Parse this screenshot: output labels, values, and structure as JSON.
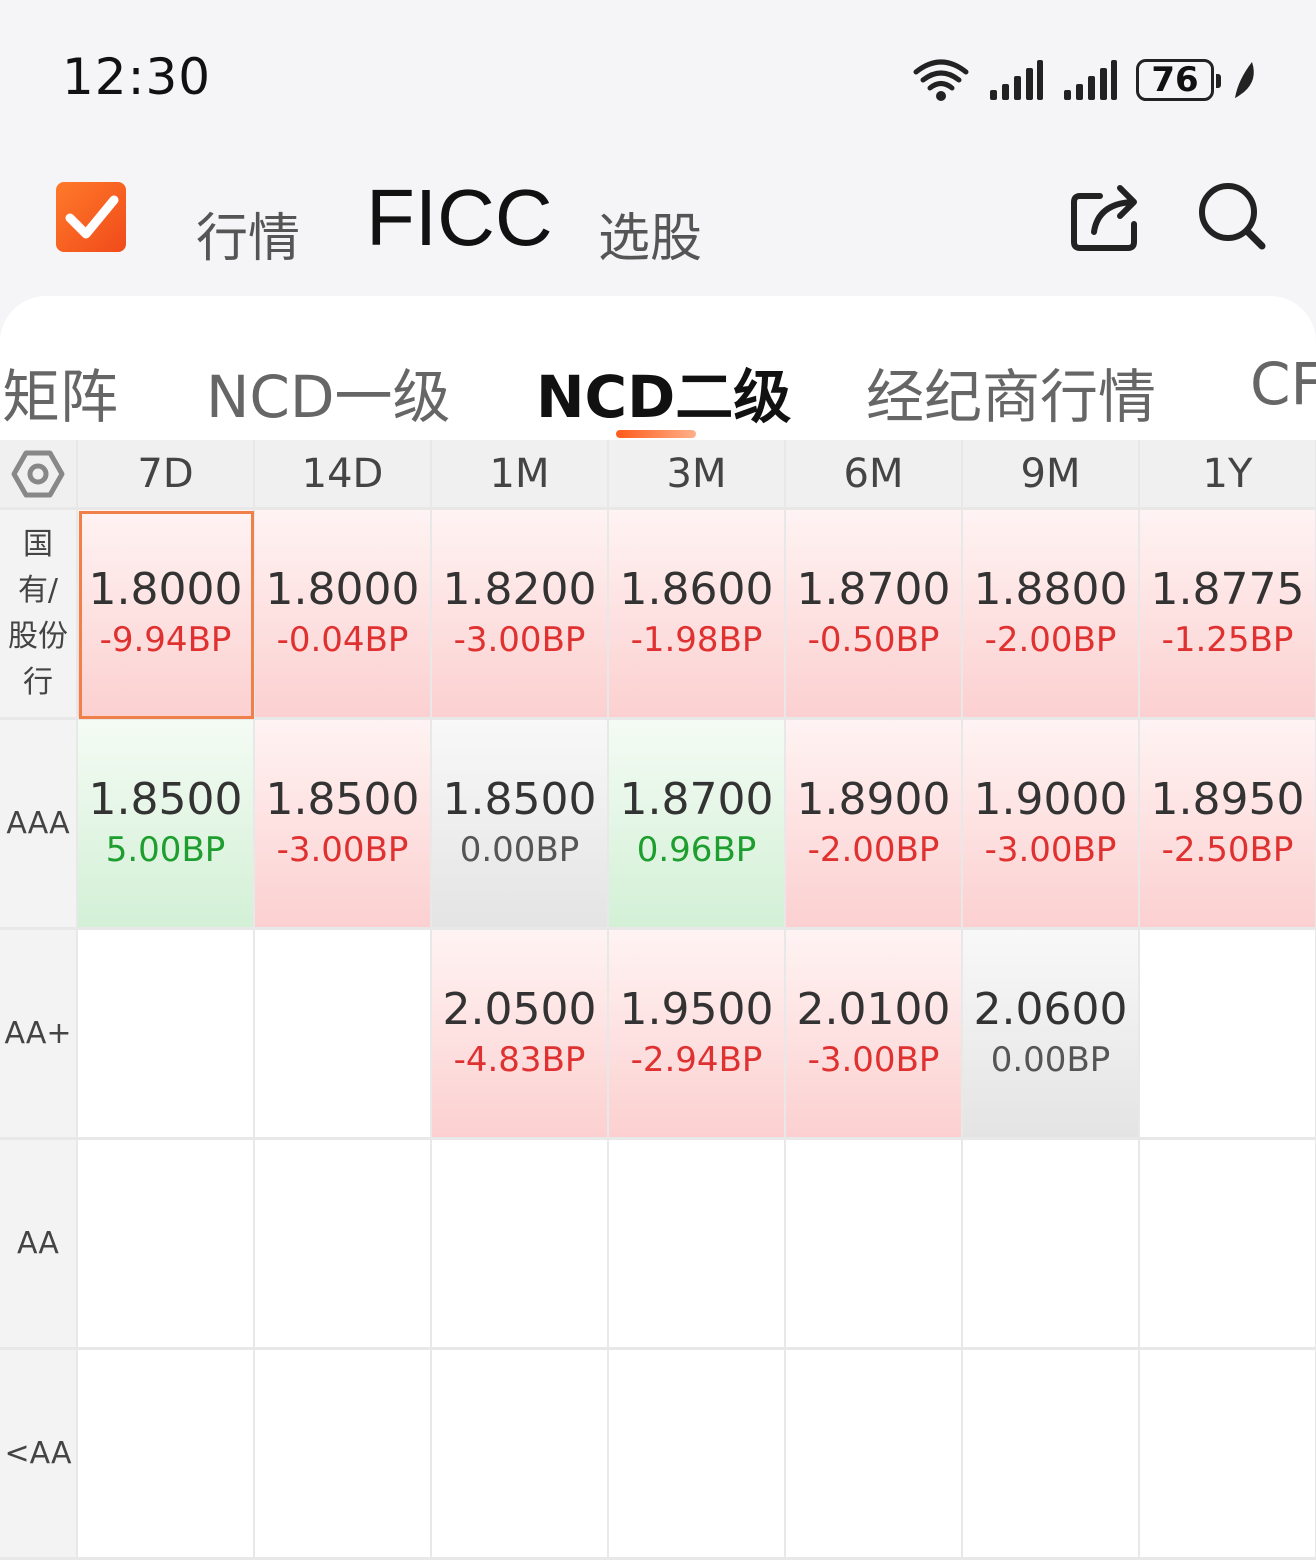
{
  "status": {
    "time": "12:30",
    "battery": "76",
    "icons": [
      "wifi-icon",
      "signal-icon",
      "signal-icon",
      "battery-icon",
      "leaf-icon"
    ]
  },
  "header": {
    "tabs": [
      {
        "label": "行情",
        "active": false
      },
      {
        "label": "FICC",
        "active": true
      },
      {
        "label": "选股",
        "active": false
      }
    ],
    "icons": [
      "share-icon",
      "search-icon"
    ]
  },
  "subtabs": [
    {
      "label": "矩阵",
      "active": false
    },
    {
      "label": "NCD一级",
      "active": false
    },
    {
      "label": "NCD二级",
      "active": true
    },
    {
      "label": "经纪商行情",
      "active": false
    },
    {
      "label": "CF",
      "active": false
    }
  ],
  "matrix": {
    "columns": [
      "7D",
      "14D",
      "1M",
      "3M",
      "6M",
      "9M",
      "1Y"
    ],
    "rows": [
      {
        "label": "国\n有/\n股份\n行",
        "cells": [
          {
            "value": "1.8000",
            "change": "-9.94BP",
            "dir": "up",
            "selected": true
          },
          {
            "value": "1.8000",
            "change": "-0.04BP",
            "dir": "up"
          },
          {
            "value": "1.8200",
            "change": "-3.00BP",
            "dir": "up"
          },
          {
            "value": "1.8600",
            "change": "-1.98BP",
            "dir": "up"
          },
          {
            "value": "1.8700",
            "change": "-0.50BP",
            "dir": "up"
          },
          {
            "value": "1.8800",
            "change": "-2.00BP",
            "dir": "up"
          },
          {
            "value": "1.8775",
            "change": "-1.25BP",
            "dir": "up"
          }
        ]
      },
      {
        "label": "AAA",
        "cells": [
          {
            "value": "1.8500",
            "change": "5.00BP",
            "dir": "down"
          },
          {
            "value": "1.8500",
            "change": "-3.00BP",
            "dir": "up"
          },
          {
            "value": "1.8500",
            "change": "0.00BP",
            "dir": "flat"
          },
          {
            "value": "1.8700",
            "change": "0.96BP",
            "dir": "down"
          },
          {
            "value": "1.8900",
            "change": "-2.00BP",
            "dir": "up"
          },
          {
            "value": "1.9000",
            "change": "-3.00BP",
            "dir": "up"
          },
          {
            "value": "1.8950",
            "change": "-2.50BP",
            "dir": "up"
          }
        ]
      },
      {
        "label": "AA+",
        "cells": [
          null,
          null,
          {
            "value": "2.0500",
            "change": "-4.83BP",
            "dir": "up"
          },
          {
            "value": "1.9500",
            "change": "-2.94BP",
            "dir": "up"
          },
          {
            "value": "2.0100",
            "change": "-3.00BP",
            "dir": "up"
          },
          {
            "value": "2.0600",
            "change": "0.00BP",
            "dir": "flat"
          },
          null
        ]
      },
      {
        "label": "AA",
        "cells": [
          null,
          null,
          null,
          null,
          null,
          null,
          null
        ]
      },
      {
        "label": "<AA",
        "cells": [
          null,
          null,
          null,
          null,
          null,
          null,
          null
        ]
      }
    ]
  }
}
